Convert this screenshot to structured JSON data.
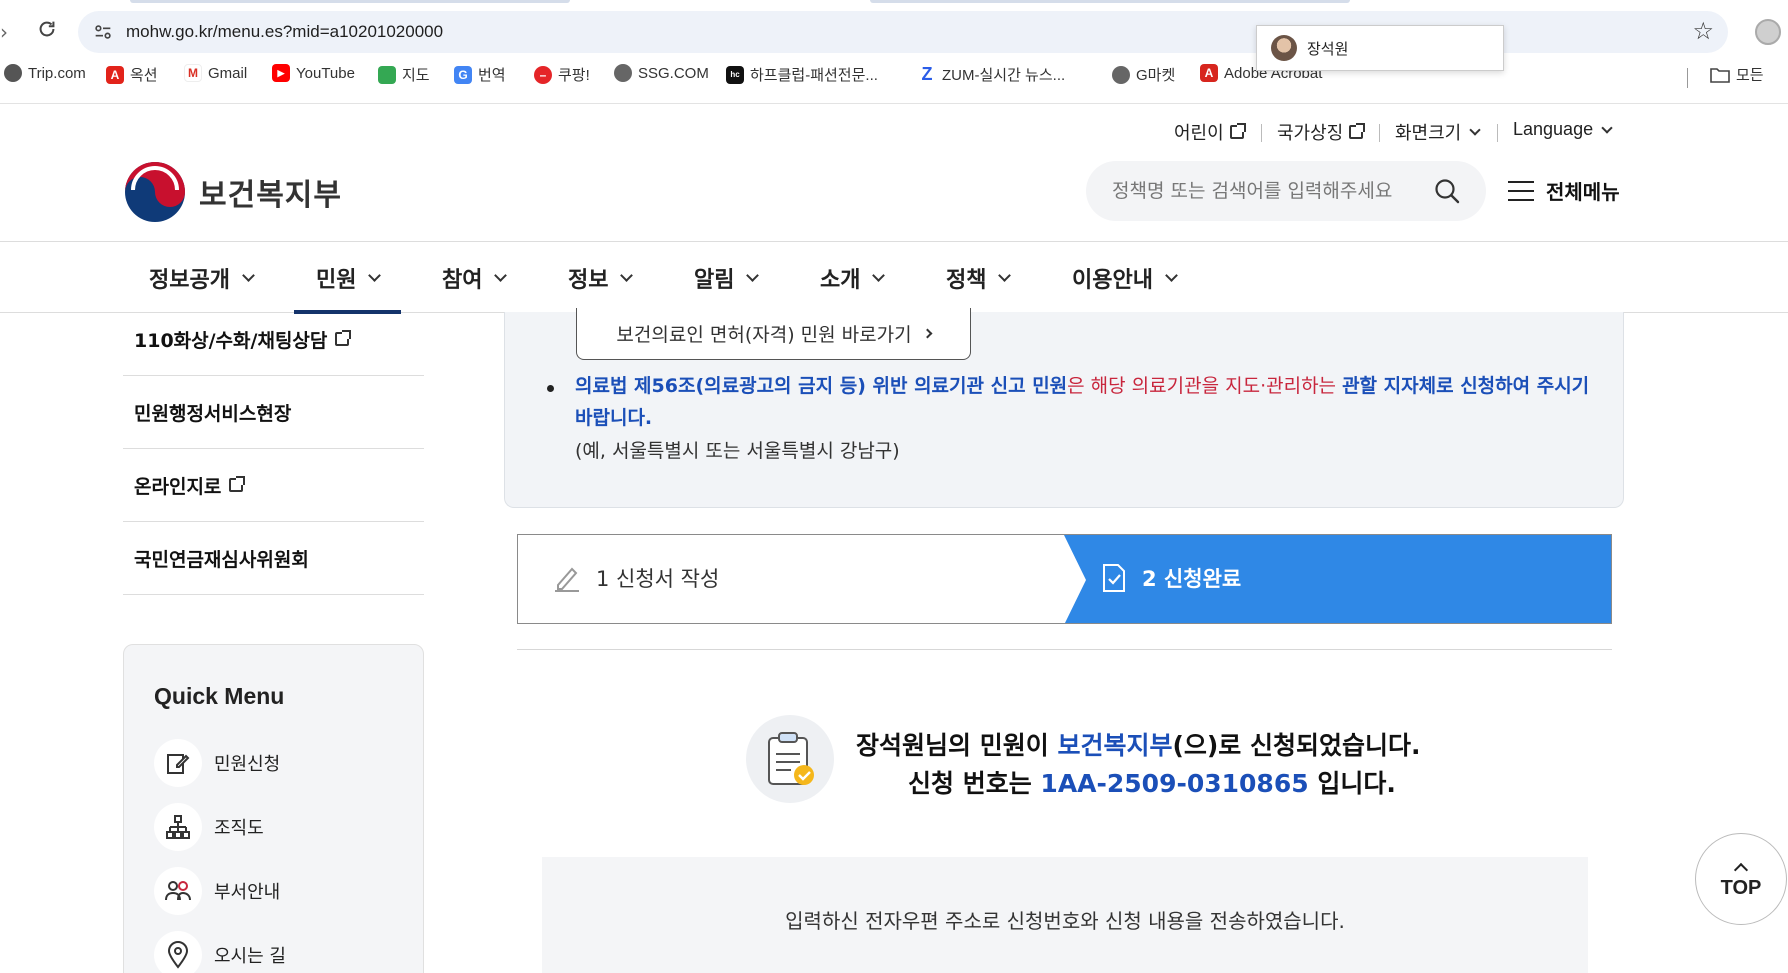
{
  "browser": {
    "url": "mohw.go.kr/menu.es?mid=a10201020000",
    "profile_popup_name": "장석원",
    "bookmarks": [
      {
        "label": "Trip.com",
        "icon": "trip-icon"
      },
      {
        "label": "옥션",
        "icon": "auction-icon"
      },
      {
        "label": "Gmail",
        "icon": "gmail-icon"
      },
      {
        "label": "YouTube",
        "icon": "youtube-icon"
      },
      {
        "label": "지도",
        "icon": "maps-icon"
      },
      {
        "label": "번역",
        "icon": "translate-icon"
      },
      {
        "label": "쿠팡!",
        "icon": "coupang-icon"
      },
      {
        "label": "SSG.COM",
        "icon": "globe-icon"
      },
      {
        "label": "하프클럽-패션전문...",
        "icon": "halfclub-icon"
      },
      {
        "label": "ZUM-실시간 뉴스...",
        "icon": "zum-icon"
      },
      {
        "label": "G마켓",
        "icon": "globe-icon"
      },
      {
        "label": "Adobe Acrobat",
        "icon": "acrobat-icon"
      },
      {
        "label": "모든",
        "icon": "folder-icon"
      }
    ]
  },
  "header": {
    "util": [
      "어린이",
      "국가상징",
      "화면크기",
      "Language"
    ],
    "logo_text": "보건복지부",
    "search_placeholder": "정책명 또는 검색어를 입력해주세요",
    "all_menu": "전체메뉴",
    "gnb": [
      "정보공개",
      "민원",
      "참여",
      "정보",
      "알림",
      "소개",
      "정책",
      "이용안내"
    ],
    "gnb_active": "민원"
  },
  "sidebar": {
    "items": [
      "110화상/수화/채팅상담",
      "민원행정서비스현장",
      "온라인지로",
      "국민연금재심사위원회"
    ],
    "quick_menu_title": "Quick Menu",
    "quick_menu": [
      {
        "label": "민원신청",
        "icon": "edit-doc-icon"
      },
      {
        "label": "조직도",
        "icon": "org-chart-icon"
      },
      {
        "label": "부서안내",
        "icon": "people-icon"
      },
      {
        "label": "오시는 길",
        "icon": "location-pin-icon"
      }
    ]
  },
  "notice": {
    "license_button": "보건의료인 면허(자격) 민원 바로가기",
    "bullet_part1": "의료법 제56조(의료광고의 금지 등) 위반 의료기관 신고 민원",
    "bullet_part2": "은 해당 의료기관을 지도·관리하는 ",
    "bullet_part3": "관할 지자체로 신청하여 주시기 바랍니다.",
    "example": "(예, 서울특별시 또는 서울특별시 강남구)"
  },
  "steps": {
    "step1": "1 신청서 작성",
    "step2": "2 신청완료"
  },
  "result": {
    "name": "장석원",
    "line1_a": "님의 민원이 ",
    "dept": "보건복지부",
    "line1_b": "(으)로 신청되었습니다.",
    "line2_a": "신청 번호는 ",
    "number": "1AA-2509-0310865",
    "line2_b": " 입니다.",
    "email_msg": "입력하신 전자우편 주소로 신청번호와 신청 내용을 전송하였습니다."
  },
  "top_button": "TOP"
}
